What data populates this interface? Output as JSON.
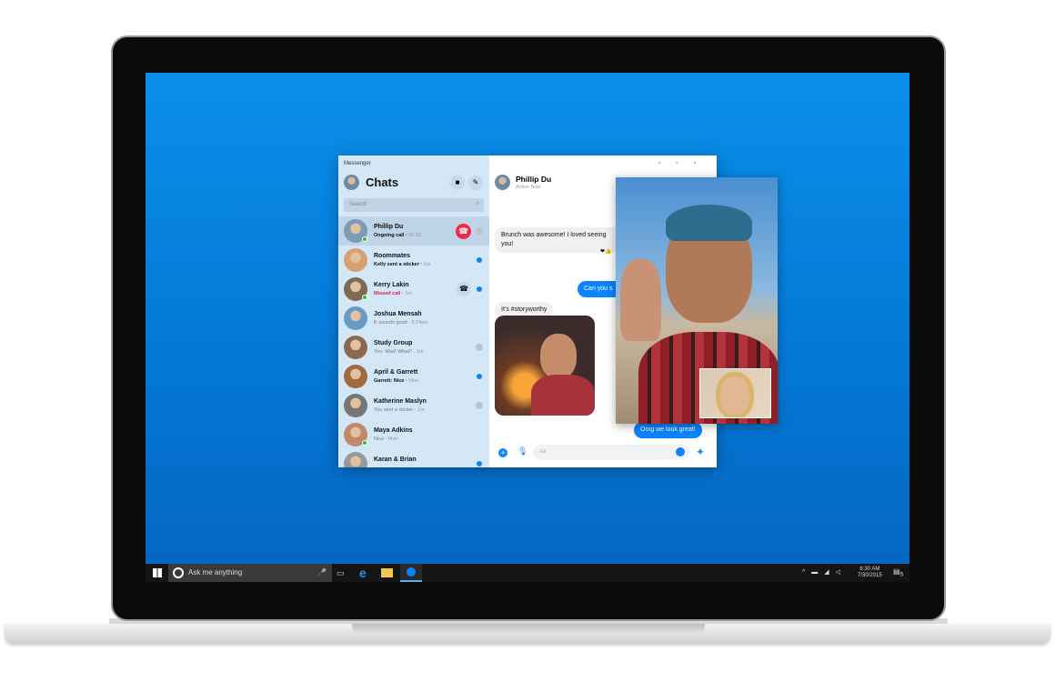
{
  "app": {
    "title": "Messenger",
    "chats_heading": "Chats",
    "search_placeholder": "Search"
  },
  "chats": [
    {
      "name": "Phillip Du",
      "snippet": "Ongoing call",
      "time": "00:33",
      "style": "b",
      "status": "read",
      "online": true,
      "action": "end-call"
    },
    {
      "name": "Roommates",
      "snippet": "Kelly sent a sticker",
      "time": "1m",
      "style": "b",
      "status": "unread"
    },
    {
      "name": "Kerry Lakin",
      "snippet": "Missed call",
      "time": "1m",
      "style": "red",
      "status": "unread",
      "online": true,
      "action": "call"
    },
    {
      "name": "Joshua Mensah",
      "snippet": "K sounds good",
      "time": "8:24am",
      "style": "",
      "status": "none"
    },
    {
      "name": "Study Group",
      "snippet": "You: Wait! What?",
      "time": "1m",
      "style": "",
      "status": "read"
    },
    {
      "name": "April & Garrett",
      "snippet": "Garrett: Nice",
      "time": "Mon",
      "style": "b",
      "status": "unread"
    },
    {
      "name": "Katherine Maslyn",
      "snippet": "You sent a sticker",
      "time": "1m",
      "style": "",
      "status": "read"
    },
    {
      "name": "Maya Adkins",
      "snippet": "Nice",
      "time": "Mon",
      "style": "",
      "status": "none",
      "online": true
    },
    {
      "name": "Karan & Brian",
      "snippet": "",
      "time": "",
      "style": "b",
      "status": "unread"
    }
  ],
  "conversation": {
    "contact": "Phillip Du",
    "presence": "Active Now",
    "messages": [
      {
        "dir": "in",
        "text": "Brunch was awesome! I loved seeing you!"
      },
      {
        "dir": "out",
        "text": "Can you s"
      },
      {
        "dir": "in",
        "text": "It's #storyworthy"
      },
      {
        "dir": "out",
        "text": "Omg we look great!"
      }
    ],
    "reactions": "❤👍",
    "composer_placeholder": "Aa"
  },
  "taskbar": {
    "search_placeholder": "Ask me anything",
    "time": "6:30 AM",
    "date": "7/30/2015",
    "notifications": "5"
  },
  "colors": {
    "accent": "#0a84ff",
    "desktop": "#0a8fe8",
    "missed": "#e41e4f",
    "end_call": "#f0284a"
  }
}
